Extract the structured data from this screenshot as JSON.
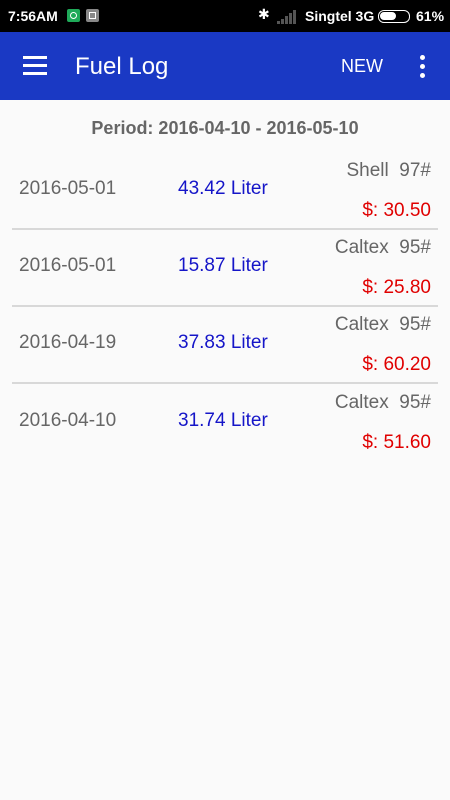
{
  "status_bar": {
    "time": "7:56AM",
    "carrier": "Singtel 3G",
    "battery": "61%",
    "battery_level": 0.61,
    "icons": [
      "notification-app-icon",
      "notification-app-icon",
      "bluetooth-icon",
      "signal-icon",
      "battery-icon"
    ]
  },
  "app_bar": {
    "title": "Fuel Log",
    "new_label": "NEW",
    "background_color": "#1a39c4"
  },
  "period": "Period: 2016-04-10 - 2016-05-10",
  "entries": [
    {
      "date": "2016-05-01",
      "volume": "43.42 Liter",
      "station": "Shell  97#",
      "price": "$: 30.50"
    },
    {
      "date": "2016-05-01",
      "volume": "15.87 Liter",
      "station": "Caltex  95#",
      "price": "$: 25.80"
    },
    {
      "date": "2016-04-19",
      "volume": "37.83 Liter",
      "station": "Caltex  95#",
      "price": "$: 60.20"
    },
    {
      "date": "2016-04-10",
      "volume": "31.74 Liter",
      "station": "Caltex  95#",
      "price": "$: 51.60"
    }
  ],
  "colors": {
    "volume": "#1515c8",
    "price": "#e00000",
    "muted_text": "#666666"
  }
}
